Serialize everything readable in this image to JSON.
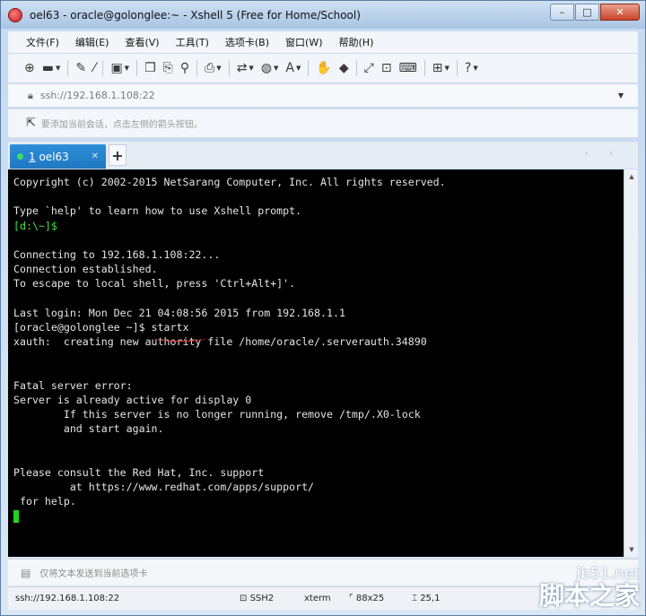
{
  "window": {
    "title": "oel63 - oracle@golonglee:~ - Xshell 5 (Free for Home/School)",
    "controls": {
      "minimize": "–",
      "maximize": "□",
      "close": "✕"
    }
  },
  "menu": {
    "items": [
      "文件(F)",
      "编辑(E)",
      "查看(V)",
      "工具(T)",
      "选项卡(B)",
      "窗口(W)",
      "帮助(H)"
    ]
  },
  "toolbar": {
    "icons": [
      {
        "name": "new-session-icon",
        "glyph": "⊕"
      },
      {
        "name": "open-folder-icon",
        "glyph": "▬",
        "dropdown": true
      },
      {
        "name": "reconnect-icon",
        "glyph": "✎"
      },
      {
        "name": "disconnect-icon",
        "glyph": "⁄"
      },
      {
        "name": "properties-icon",
        "glyph": "▣",
        "dropdown": true
      },
      {
        "name": "copy-icon",
        "glyph": "❐"
      },
      {
        "name": "paste-icon",
        "glyph": "⎘"
      },
      {
        "name": "find-icon",
        "glyph": "⚲"
      },
      {
        "name": "print-icon",
        "glyph": "⎙",
        "dropdown": true
      },
      {
        "name": "transfer-icon",
        "glyph": "⇄",
        "dropdown": true
      },
      {
        "name": "globe-icon",
        "glyph": "◍",
        "dropdown": true
      },
      {
        "name": "font-icon",
        "glyph": "A",
        "dropdown": true
      },
      {
        "name": "script-icon",
        "glyph": "✋"
      },
      {
        "name": "tunnel-icon",
        "glyph": "◆"
      },
      {
        "name": "fullscreen-icon",
        "glyph": "⤢"
      },
      {
        "name": "lock-icon",
        "glyph": "⊡"
      },
      {
        "name": "keyboard-icon",
        "glyph": "⌨"
      },
      {
        "name": "add-icon",
        "glyph": "⊞",
        "dropdown": true
      },
      {
        "name": "help-icon",
        "glyph": "?",
        "dropdown": true
      }
    ]
  },
  "address": {
    "value": "ssh://192.168.1.108:22",
    "dropdown": "▼"
  },
  "hint": {
    "text": "要添加当前会话，点击左侧的箭头按钮。"
  },
  "tabs": {
    "active": {
      "number": "1",
      "label": "oel63",
      "close": "✕"
    },
    "add": "+",
    "nav": "‹ ›"
  },
  "terminal": {
    "lines": [
      {
        "text": "Copyright (c) 2002-2015 NetSarang Computer, Inc. All rights reserved.",
        "green": false
      },
      {
        "text": "",
        "green": false
      },
      {
        "text": "Type `help' to learn how to use Xshell prompt.",
        "green": false
      },
      {
        "text": "[d:\\~]$",
        "green": true
      },
      {
        "text": "",
        "green": false
      },
      {
        "text": "Connecting to 192.168.1.108:22...",
        "green": false
      },
      {
        "text": "Connection established.",
        "green": false
      },
      {
        "text": "To escape to local shell, press 'Ctrl+Alt+]'.",
        "green": false
      },
      {
        "text": "",
        "green": false
      },
      {
        "text": "Last login: Mon Dec 21 04:08:56 2015 from 192.168.1.1",
        "green": false
      },
      {
        "text": "[oracle@golonglee ~]$ startx",
        "green": false
      },
      {
        "text": "xauth:  creating new authority file /home/oracle/.serverauth.34890",
        "green": false
      },
      {
        "text": "",
        "green": false
      },
      {
        "text": "",
        "green": false
      },
      {
        "text": "Fatal server error:",
        "green": false
      },
      {
        "text": "Server is already active for display 0",
        "green": false
      },
      {
        "text": "        If this server is no longer running, remove /tmp/.X0-lock",
        "green": false
      },
      {
        "text": "        and start again.",
        "green": false
      },
      {
        "text": "",
        "green": false
      },
      {
        "text": "",
        "green": false
      },
      {
        "text": "Please consult the Red Hat, Inc. support",
        "green": false
      },
      {
        "text": "         at https://www.redhat.com/apps/support/",
        "green": false
      },
      {
        "text": " for help.",
        "green": false
      },
      {
        "text": "",
        "green": false
      }
    ]
  },
  "compose": {
    "text": "仅将文本发送到当前选项卡"
  },
  "status": {
    "connection": "ssh://192.168.1.108:22",
    "protocol": "SSH2",
    "term": "xterm",
    "size": "88x25",
    "position": "25,1"
  },
  "watermark": {
    "top": "jb51.net",
    "bottom": "脚本之家"
  },
  "colors": {
    "terminal_bg": "#000000",
    "terminal_fg": "#e4e4e4",
    "prompt_green": "#3ce63c",
    "tab_active": "#1f78c2"
  }
}
